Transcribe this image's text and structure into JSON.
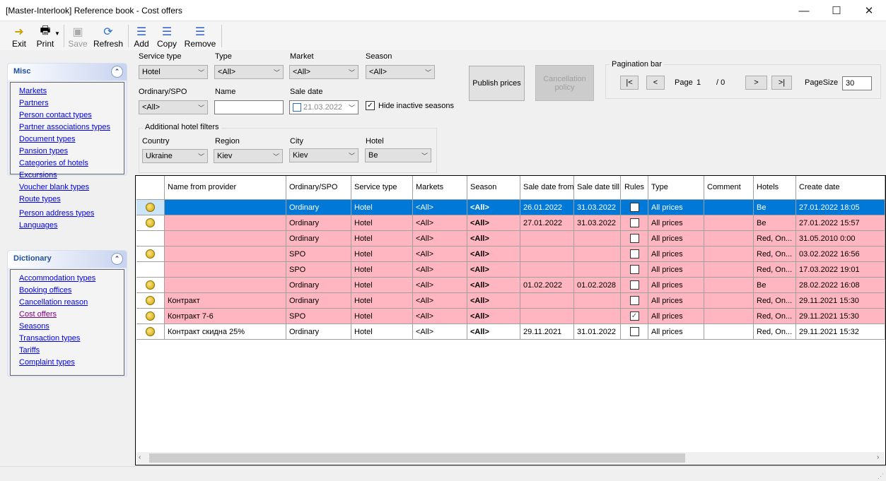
{
  "window": {
    "title": "[Master-Interlook] Reference book - Cost offers",
    "minimize": "—",
    "maximize": "☐",
    "close": "✕"
  },
  "toolbar": {
    "exit": "Exit",
    "print": "Print",
    "save": "Save",
    "refresh": "Refresh",
    "add": "Add",
    "copy": "Copy",
    "remove": "Remove"
  },
  "sidebar": {
    "misc": {
      "title": "Misc",
      "items": [
        "Markets",
        "Partners",
        "Person contact types",
        "Partner  associations types",
        "Document types",
        "Pansion types",
        "Categories of hotels",
        "Excursions",
        "Voucher blank types",
        "Route types",
        "Person address types",
        "Languages"
      ]
    },
    "dictionary": {
      "title": "Dictionary",
      "items": [
        "Accommodation types",
        "Booking offices",
        "Cancellation reason",
        "Cost offers",
        "Seasons",
        "Transaction types",
        "Tariffs",
        "Complaint types"
      ],
      "active": "Cost offers"
    }
  },
  "filters": {
    "service_type": {
      "label": "Service type",
      "value": "Hotel"
    },
    "type": {
      "label": "Type",
      "value": "<All>"
    },
    "market": {
      "label": "Market",
      "value": "<All>"
    },
    "season": {
      "label": "Season",
      "value": "<All>"
    },
    "ordinary_spo": {
      "label": "Ordinary/SPO",
      "value": "<All>"
    },
    "name": {
      "label": "Name",
      "value": ""
    },
    "sale_date": {
      "label": "Sale date",
      "value": "21.03.2022",
      "checked": false
    },
    "hide_inactive": {
      "label": "Hide inactive seasons",
      "checked": true
    },
    "additional": {
      "title": "Additional hotel filters",
      "country": {
        "label": "Country",
        "value": "Ukraine"
      },
      "region": {
        "label": "Region",
        "value": "Kiev"
      },
      "city": {
        "label": "City",
        "value": "Kiev"
      },
      "hotel": {
        "label": "Hotel",
        "value": "Be"
      }
    }
  },
  "actions": {
    "publish": "Publish prices",
    "cancellation": "Cancellation policy"
  },
  "pagination": {
    "title": "Pagination bar",
    "first": "|<",
    "prev": "<",
    "page_label": "Page",
    "page": "1",
    "total": "/ 0",
    "next": ">",
    "last": ">|",
    "page_size_label": "PageSize",
    "page_size": "30"
  },
  "colors": {
    "selected": "#0078d7",
    "inactive_row": "#ffb6c1"
  },
  "grid": {
    "columns": [
      "",
      "Name from provider",
      "Ordinary/SPO",
      "Service type",
      "Markets",
      "Season",
      "Sale date from",
      "Sale date till",
      "Rules",
      "Type",
      "Comment",
      "Hotels",
      "Create date"
    ],
    "rows": [
      {
        "icon": true,
        "name": "",
        "kind": "Ordinary",
        "service": "Hotel",
        "markets": "<All>",
        "season": "<All>",
        "from": "26.01.2022",
        "till": "31.03.2022",
        "rules": false,
        "type": "All prices",
        "comment": "",
        "hotels": "Be",
        "created": "27.01.2022 18:05",
        "state": "selected"
      },
      {
        "icon": true,
        "name": "",
        "kind": "Ordinary",
        "service": "Hotel",
        "markets": "<All>",
        "season": "<All>",
        "from": "27.01.2022",
        "till": "31.03.2022",
        "rules": false,
        "type": "All prices",
        "comment": "",
        "hotels": "Be",
        "created": "27.01.2022 15:57",
        "state": "inactive"
      },
      {
        "icon": false,
        "name": "",
        "kind": "Ordinary",
        "service": "Hotel",
        "markets": "<All>",
        "season": "<All>",
        "from": "",
        "till": "",
        "rules": false,
        "type": "All prices",
        "comment": "",
        "hotels": "Red, On...",
        "created": "31.05.2010 0:00",
        "state": "inactive"
      },
      {
        "icon": true,
        "name": "",
        "kind": "SPO",
        "service": "Hotel",
        "markets": "<All>",
        "season": "<All>",
        "from": "",
        "till": "",
        "rules": false,
        "type": "All prices",
        "comment": "",
        "hotels": "Red, On...",
        "created": "03.02.2022 16:56",
        "state": "inactive"
      },
      {
        "icon": false,
        "name": "",
        "kind": "SPO",
        "service": "Hotel",
        "markets": "<All>",
        "season": "<All>",
        "from": "",
        "till": "",
        "rules": false,
        "type": "All prices",
        "comment": "",
        "hotels": "Red, On...",
        "created": "17.03.2022 19:01",
        "state": "inactive"
      },
      {
        "icon": true,
        "name": "",
        "kind": "Ordinary",
        "service": "Hotel",
        "markets": "<All>",
        "season": "<All>",
        "from": "01.02.2022",
        "till": "01.02.2028",
        "rules": false,
        "type": "All prices",
        "comment": "",
        "hotels": "Be",
        "created": "28.02.2022 16:08",
        "state": "inactive"
      },
      {
        "icon": true,
        "name": "Контракт",
        "kind": "Ordinary",
        "service": "Hotel",
        "markets": "<All>",
        "season": "<All>",
        "from": "",
        "till": "",
        "rules": false,
        "type": "All prices",
        "comment": "",
        "hotels": "Red, On...",
        "created": "29.11.2021 15:30",
        "state": "inactive"
      },
      {
        "icon": true,
        "name": "Контракт 7-6",
        "kind": "SPO",
        "service": "Hotel",
        "markets": "<All>",
        "season": "<All>",
        "from": "",
        "till": "",
        "rules": true,
        "type": "All prices",
        "comment": "",
        "hotels": "Red, On...",
        "created": "29.11.2021 15:30",
        "state": "inactive"
      },
      {
        "icon": true,
        "name": "Контракт скидна 25%",
        "kind": "Ordinary",
        "service": "Hotel",
        "markets": "<All>",
        "season": "<All>",
        "from": "29.11.2021",
        "till": "31.01.2022",
        "rules": false,
        "type": "All prices",
        "comment": "",
        "hotels": "Red, On...",
        "created": "29.11.2021 15:32",
        "state": "normal"
      }
    ]
  }
}
